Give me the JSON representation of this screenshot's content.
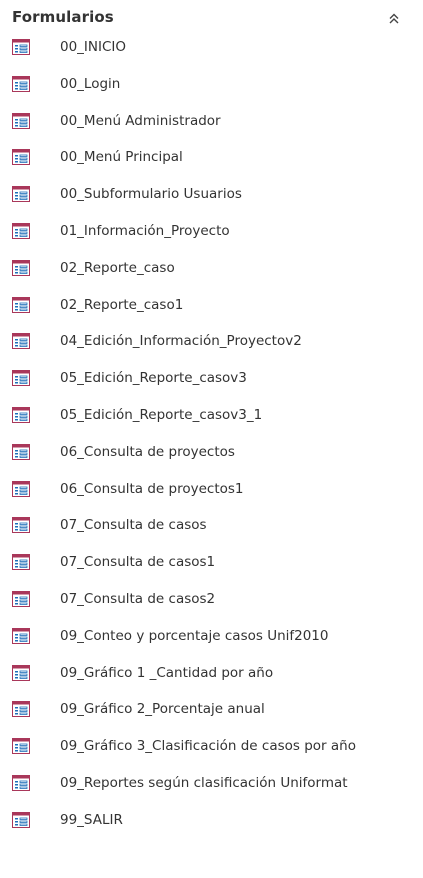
{
  "nav_pane": {
    "group_title": "Formularios",
    "collapse_icon": "chevron-double-up-icon",
    "item_icon": "form-icon",
    "items": [
      "00_INICIO",
      "00_Login",
      "00_Menú Administrador",
      "00_Menú Principal",
      "00_Subformulario Usuarios",
      "01_Información_Proyecto",
      "02_Reporte_caso",
      "02_Reporte_caso1",
      "04_Edición_Información_Proyectov2",
      "05_Edición_Reporte_casov3",
      "05_Edición_Reporte_casov3_1",
      "06_Consulta de proyectos",
      "06_Consulta de proyectos1",
      "07_Consulta de casos",
      "07_Consulta de casos1",
      "07_Consulta de casos2",
      "09_Conteo y porcentaje casos Unif2010",
      "09_Gráfico 1 _Cantidad por año",
      "09_Gráfico 2_Porcentaje anual",
      "09_Gráfico 3_Clasificación de casos por año",
      "09_Reportes según clasificación Uniformat",
      "99_SALIR"
    ]
  },
  "colors": {
    "icon_frame": "#a9375a",
    "icon_fill": "#ffffff",
    "icon_line": "#1f6fb8",
    "text": "#333333"
  }
}
